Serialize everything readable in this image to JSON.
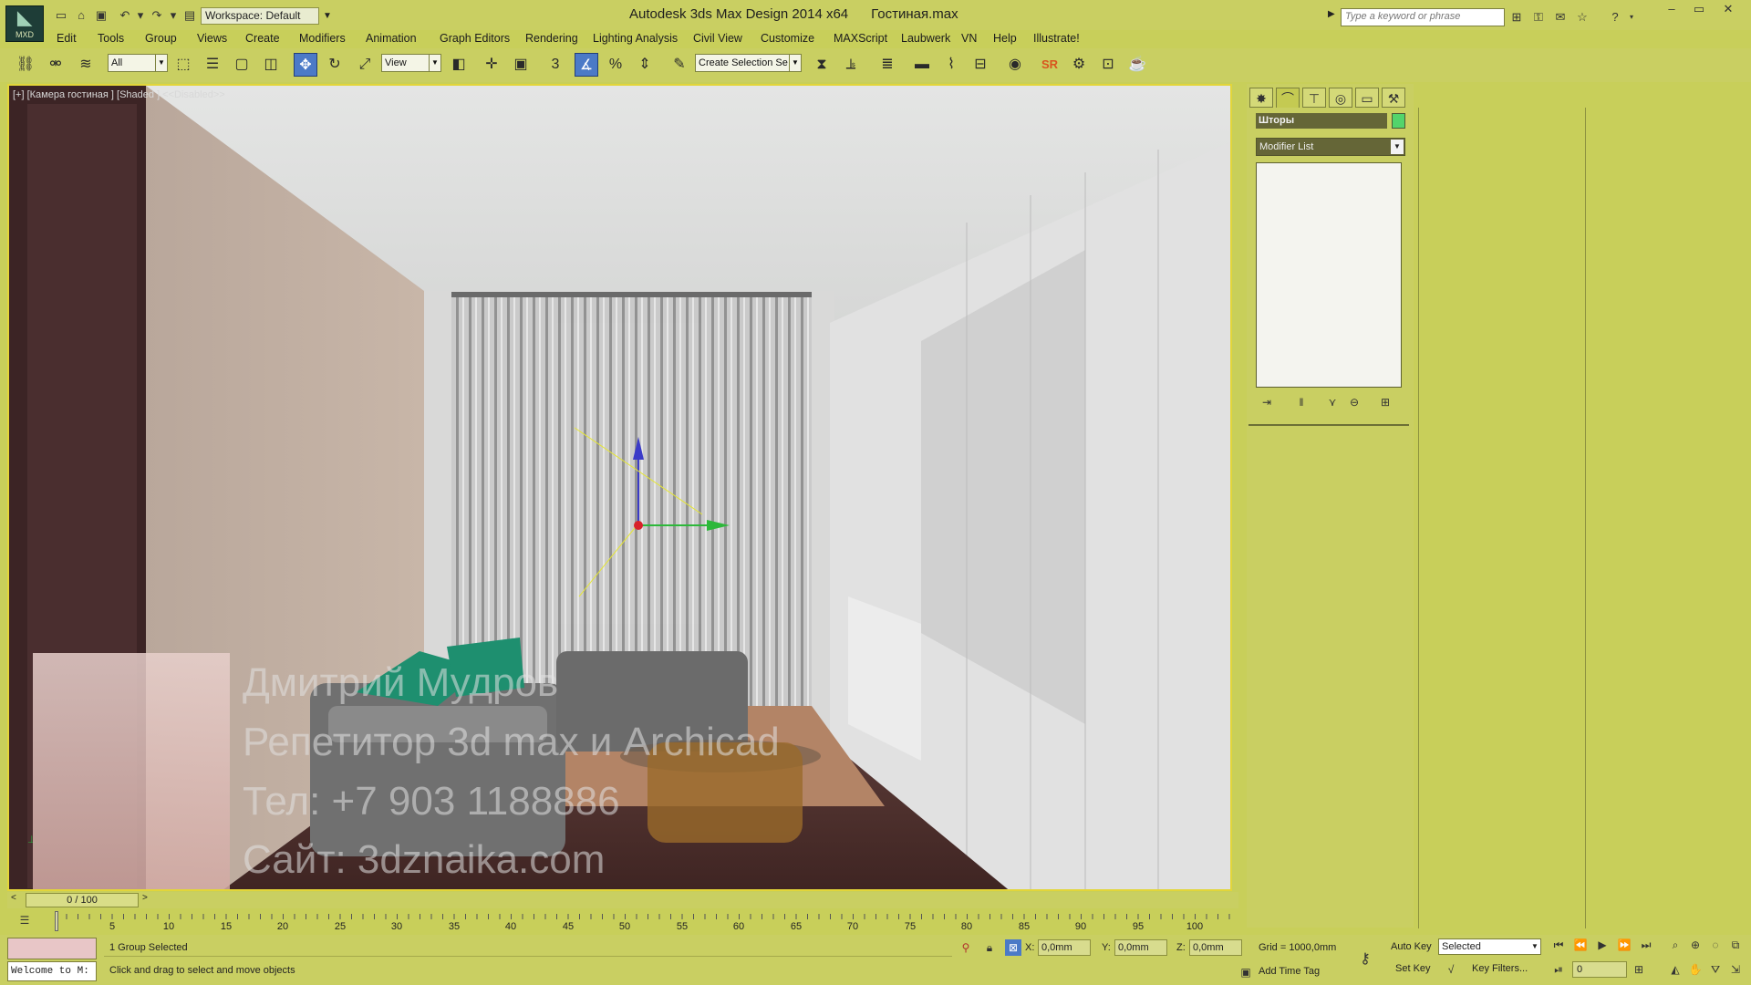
{
  "title_bar": {
    "logo_text": "MXD",
    "workspace": "Workspace: Default",
    "title": "Autodesk 3ds Max Design 2014 x64      Гостиная.max",
    "search_placeholder": "Type a keyword or phrase"
  },
  "menu": [
    "Edit",
    "Tools",
    "Group",
    "Views",
    "Create",
    "Modifiers",
    "Animation",
    "Graph Editors",
    "Rendering",
    "Lighting Analysis",
    "Civil View",
    "Customize",
    "MAXScript",
    "Laubwerk",
    "VN",
    "Help",
    "Illustrate!"
  ],
  "toolbar": {
    "selection_filter": "All",
    "ref_coord": "View",
    "named_selection": "Create Selection Se"
  },
  "viewport": {
    "label": "[+] [Камера гостиная ] [Shaded ] <<Disabled>>",
    "overlay_lines": [
      "Дмитрий Мудров",
      "Репетитор 3d max и Archicad",
      "Тел: +7 903 1188886",
      "Сайт: 3dznaika.com"
    ]
  },
  "command_panel": {
    "object_name": "Шторы",
    "object_color": "#53d46b",
    "modifier_list": "Modifier List"
  },
  "timeline": {
    "frame_display": "0 / 100",
    "ticks": [
      "5",
      "10",
      "15",
      "20",
      "25",
      "30",
      "35",
      "40",
      "45",
      "50",
      "55",
      "60",
      "65",
      "70",
      "75",
      "80",
      "85",
      "90",
      "95",
      "100"
    ]
  },
  "status": {
    "maxscript_output": "Welcome to M:",
    "selection_text": "1 Group Selected",
    "prompt_text": "Click and drag to select and move objects",
    "x_label": "X:",
    "x_value": "0,0mm",
    "y_label": "Y:",
    "y_value": "0,0mm",
    "z_label": "Z:",
    "z_value": "0,0mm",
    "grid": "Grid = 1000,0mm",
    "add_time_tag": "Add Time Tag",
    "auto_key": "Auto Key",
    "set_key": "Set Key",
    "key_mode": "Selected",
    "key_filters": "Key Filters...",
    "current_frame": "0"
  },
  "colors": {
    "ui_background": "#c9cf62",
    "viewport_border": "#e2d53a",
    "active_tool": "#4b7ac7"
  }
}
